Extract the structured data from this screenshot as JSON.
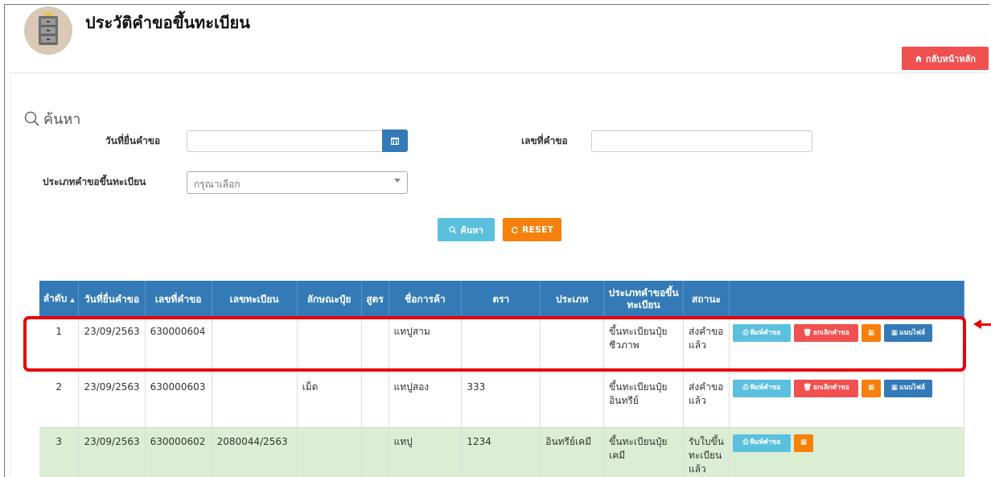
{
  "page": {
    "title": "ประวัติคำขอขึ้นทะเบียน",
    "home_button": "กลับหน้าหลัก"
  },
  "search": {
    "heading": "ค้นหา",
    "date_label": "วันที่ยื่นคำขอ",
    "date_value": "",
    "request_no_label": "เลขที่คำขอ",
    "request_no_value": "",
    "type_label": "ประเภทคำขอขึ้นทะเบียน",
    "type_placeholder": "กรุณาเลือก",
    "search_button": "ค้นหา",
    "reset_button": "RESET"
  },
  "table": {
    "headers": [
      "ลำดับ",
      "วันที่ยื่นคำขอ",
      "เลขที่คำขอ",
      "เลขทะเบียน",
      "ลักษณะปุ๋ย",
      "สูตร",
      "ชื่อการค้า",
      "ตรา",
      "ประเภท",
      "ประเภทคำขอขึ้นทะเบียน",
      "สถานะ",
      ""
    ],
    "sort_indicator": "▲",
    "rows": [
      {
        "no": "1",
        "date": "23/09/2563",
        "request_no": "630000604",
        "reg_no": "",
        "form": "",
        "formula": "",
        "trade_name": "แทปูสาม",
        "brand": "",
        "type": "",
        "request_type": "ขึ้นทะเบียนปุ๋ยชีวภาพ",
        "status": "ส่งคำขอแล้ว"
      },
      {
        "no": "2",
        "date": "23/09/2563",
        "request_no": "630000603",
        "reg_no": "",
        "form": "เม็ด",
        "formula": "",
        "trade_name": "แทปูสอง",
        "brand": "333",
        "type": "",
        "request_type": "ขึ้นทะเบียนปุ๋ยอินทรีย์",
        "status": "ส่งคำขอแล้ว"
      },
      {
        "no": "3",
        "date": "23/09/2563",
        "request_no": "630000602",
        "reg_no": "2080044/2563",
        "form": "",
        "formula": "",
        "trade_name": "แทปู",
        "brand": "1234",
        "type": "อินทรีย์เคมี",
        "request_type": "ขึ้นทะเบียนปุ๋ยเคมี",
        "status": "รับใบขึ้นทะเบียนแล้ว"
      }
    ],
    "actions": {
      "print": "พิมพ์คำขอ",
      "cancel": "ยกเลิกคำขอ",
      "attach": "แนบไฟล์"
    }
  },
  "colors": {
    "primary": "#337ab7",
    "danger": "#f0504f",
    "warning": "#f7800a",
    "info": "#5bc0de",
    "success_row": "#dbeed3",
    "highlight": "#e8000b"
  }
}
